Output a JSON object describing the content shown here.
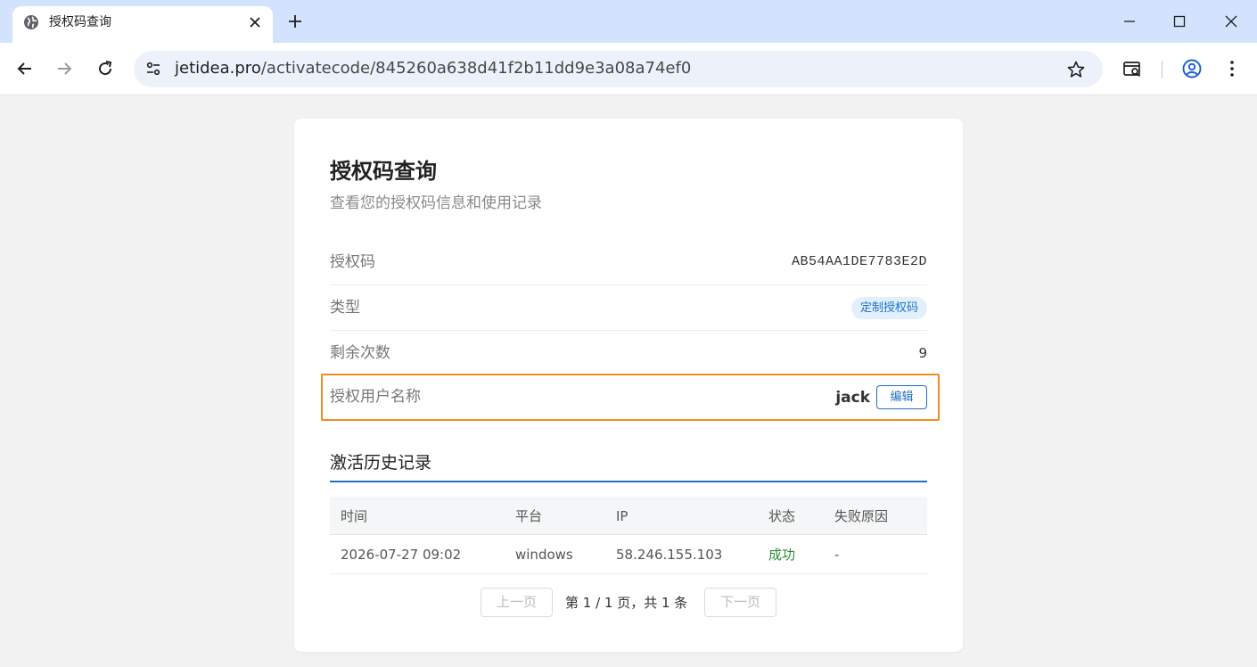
{
  "browser": {
    "tab_title": "授权码查询",
    "url_host": "jetidea.pro",
    "url_path": "/activatecode/845260a638d41f2b11dd9e3a08a74ef0"
  },
  "card": {
    "title": "授权码查询",
    "subtitle": "查看您的授权码信息和使用记录",
    "fields": [
      {
        "label": "授权码",
        "value": "AB54AA1DE7783E2D"
      },
      {
        "label": "类型",
        "value": "定制授权码"
      },
      {
        "label": "剩余次数",
        "value": "9"
      },
      {
        "label": "授权用户名称",
        "value": "jack",
        "action": "编辑"
      }
    ]
  },
  "history": {
    "title": "激活历史记录",
    "columns": [
      "时间",
      "平台",
      "IP",
      "状态",
      "失败原因"
    ],
    "rows": [
      [
        "2026-07-27 09:02",
        "windows",
        "58.246.155.103",
        "成功",
        "-"
      ]
    ]
  },
  "pager": {
    "prev": "上一页",
    "info": "第 1 / 1 页，共 1 条",
    "next": "下一页"
  },
  "colors": {
    "accent": "#1f6fbf",
    "highlight_border": "#f08a24",
    "success": "#2e8b3a",
    "tabstrip": "#d3e3fd"
  }
}
